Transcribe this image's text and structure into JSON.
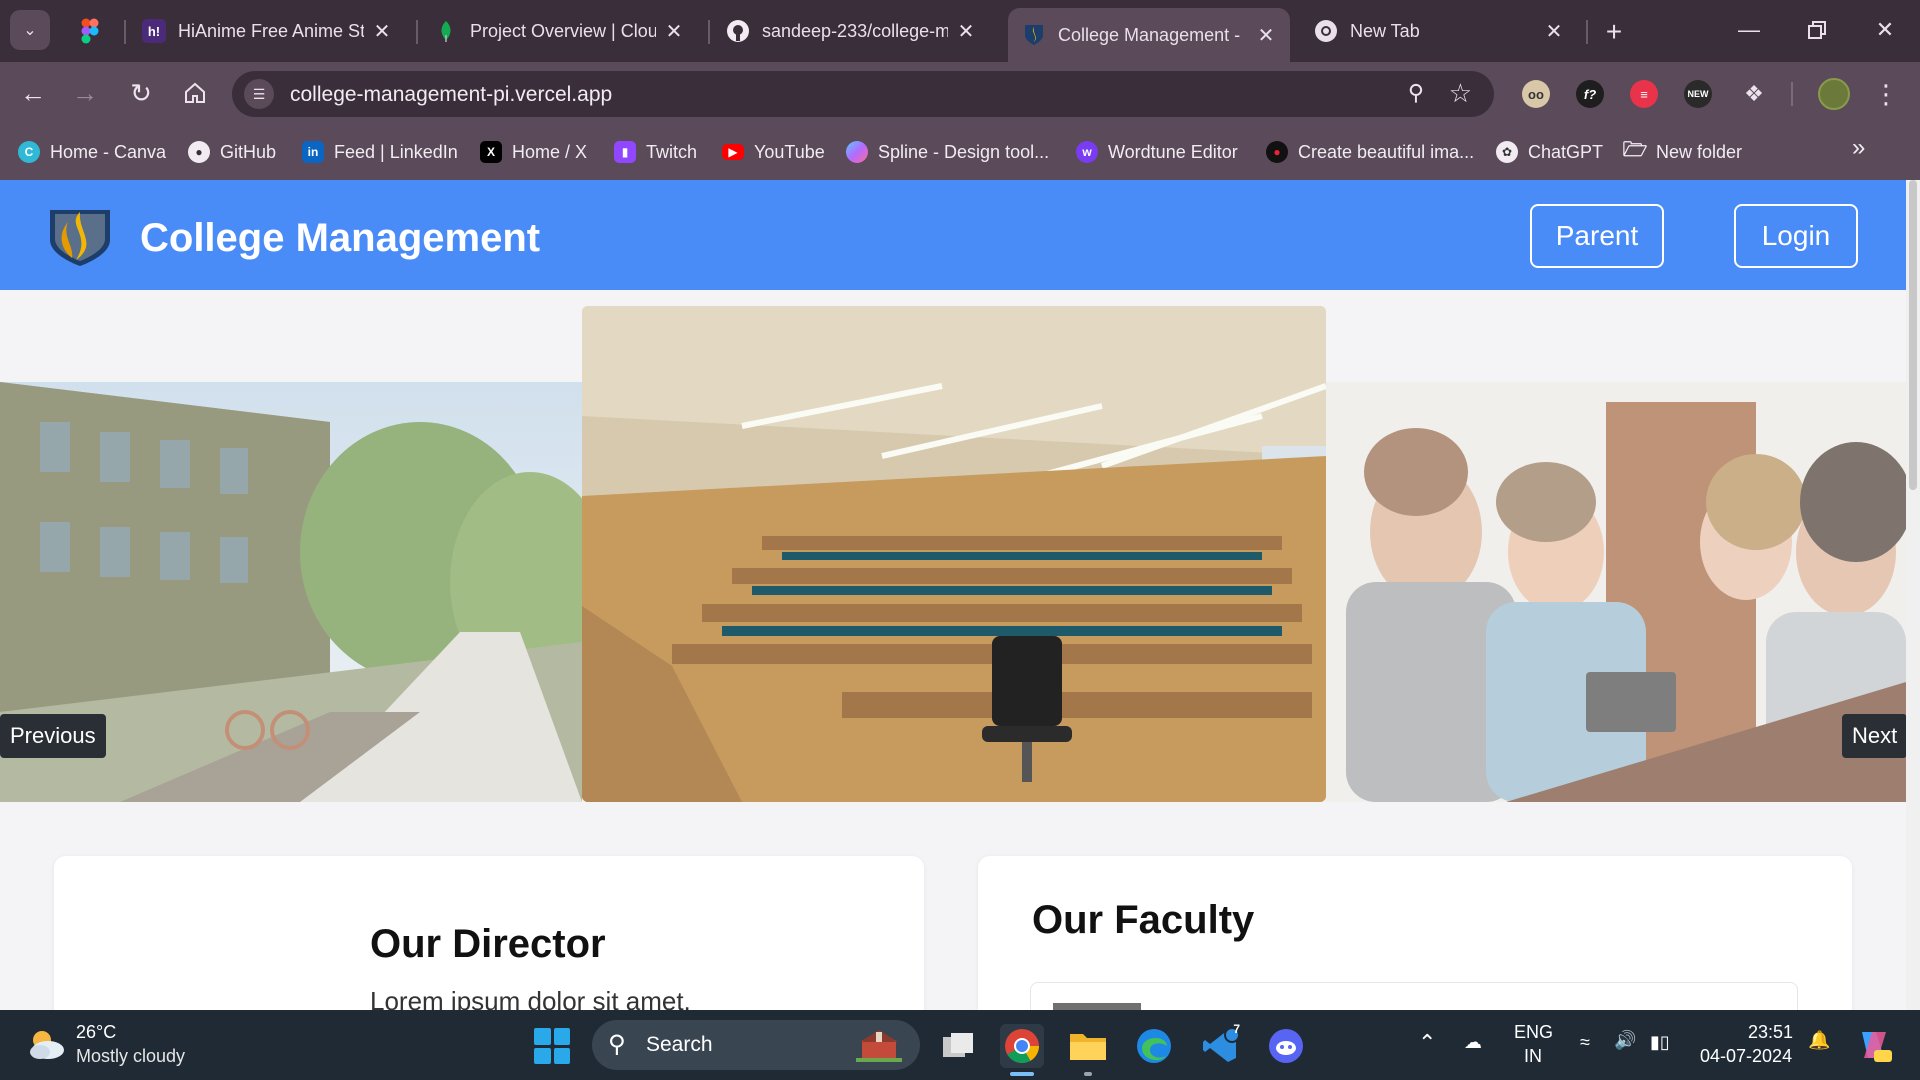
{
  "browser": {
    "tabs": [
      {
        "title": "HiAnime Free Anime St",
        "favicon": "hianime-icon",
        "active": false
      },
      {
        "title": "Project Overview | Clou",
        "favicon": "mongodb-leaf-icon",
        "active": false
      },
      {
        "title": "sandeep-233/college-m",
        "favicon": "github-icon",
        "active": false
      },
      {
        "title": "College Management -",
        "favicon": "college-shield-icon",
        "active": true
      },
      {
        "title": "New Tab",
        "favicon": "chrome-icon",
        "active": false
      }
    ],
    "address_bar": {
      "url": "college-management-pi.vercel.app"
    },
    "bookmarks": [
      {
        "label": "Home - Canva",
        "icon": "canva-icon"
      },
      {
        "label": "GitHub",
        "icon": "github-icon"
      },
      {
        "label": "Feed | LinkedIn",
        "icon": "linkedin-icon"
      },
      {
        "label": "Home / X",
        "icon": "x-icon"
      },
      {
        "label": "Twitch",
        "icon": "twitch-icon"
      },
      {
        "label": "YouTube",
        "icon": "youtube-icon"
      },
      {
        "label": "Spline - Design tool...",
        "icon": "spline-icon"
      },
      {
        "label": "Wordtune Editor",
        "icon": "wordtune-icon"
      },
      {
        "label": "Create beautiful ima...",
        "icon": "create-icon"
      },
      {
        "label": "ChatGPT",
        "icon": "chatgpt-icon"
      },
      {
        "label": "New folder",
        "icon": "folder-icon"
      }
    ],
    "extensions": [
      {
        "name": "glasses-extension-icon",
        "label": ""
      },
      {
        "name": "font-extension-icon",
        "label": "f?"
      },
      {
        "name": "red-extension-icon",
        "label": ""
      },
      {
        "name": "new-extension-icon",
        "label": "NEW"
      }
    ]
  },
  "site": {
    "brand": "College Management",
    "nav": {
      "parent": "Parent",
      "login": "Login"
    },
    "carousel": {
      "previous": "Previous",
      "next": "Next",
      "slides": [
        "campus-building-photo",
        "lecture-hall-photo",
        "students-photo"
      ]
    },
    "director": {
      "heading": "Our Director",
      "text": "Lorem ipsum dolor sit amet,"
    },
    "faculty": {
      "heading": "Our Faculty"
    }
  },
  "taskbar": {
    "weather": {
      "temp": "26°C",
      "desc": "Mostly cloudy"
    },
    "search": "Search",
    "lang": {
      "line1": "ENG",
      "line2": "IN"
    },
    "time": "23:51",
    "date": "04-07-2024",
    "badge": "7"
  },
  "colors": {
    "navbar": "#4a8cf7",
    "chrome_dark": "#3b2e3b",
    "chrome": "#5a4a5a",
    "taskbar": "#1f2a35"
  }
}
